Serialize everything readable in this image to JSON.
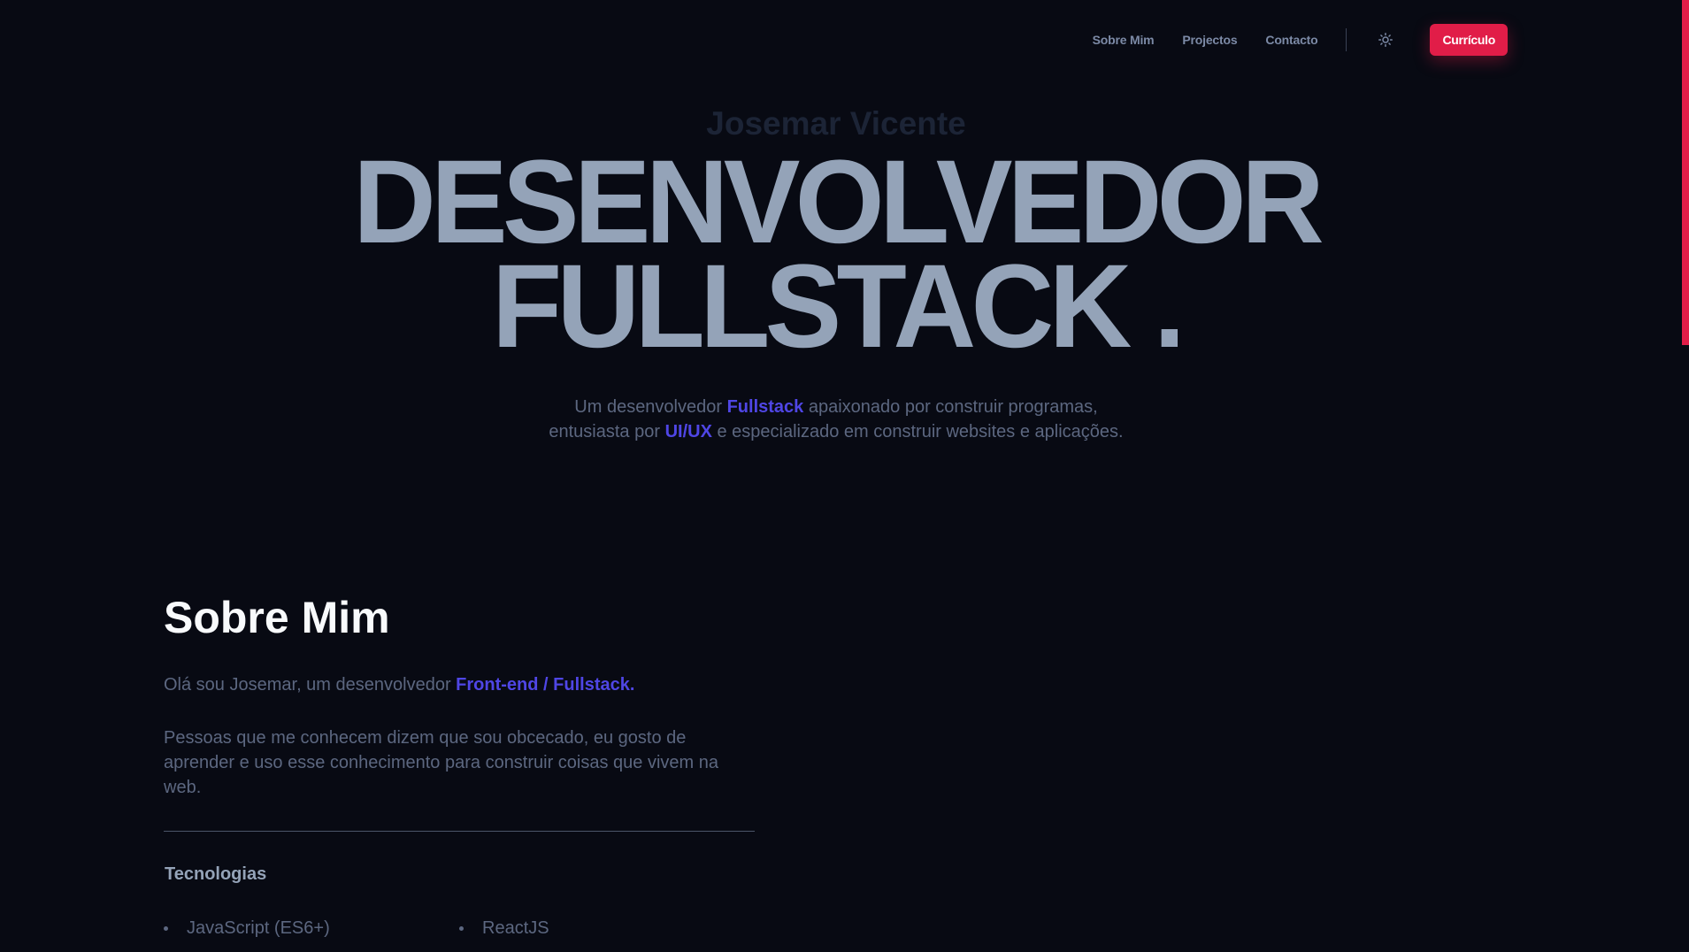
{
  "nav": {
    "links": [
      {
        "label": "Sobre Mim"
      },
      {
        "label": "Projectos"
      },
      {
        "label": "Contacto"
      }
    ],
    "theme_icon": "sun-icon",
    "resume_label": "Currículo"
  },
  "hero": {
    "name": "Josemar Vicente",
    "title_line1": "DESENVOLVEDOR",
    "title_line2": "FULLSTACK .",
    "sub_part1": "Um desenvolvedor ",
    "sub_accent1": "Fullstack",
    "sub_part2": " apaixonado por construir programas,",
    "sub_part3": "entusiasta por ",
    "sub_accent2": "UI/UX",
    "sub_part4": " e especializado em construir websites e aplicações."
  },
  "about": {
    "title": "Sobre Mim",
    "intro_part1": "Olá sou Josemar, um desenvolvedor ",
    "intro_accent": "Front-end / Fullstack.",
    "paragraph": "Pessoas que me conhecem dizem que sou obcecado, eu gosto de aprender e uso esse conhecimento para construir coisas que vivem na web.",
    "tech_title": "Tecnologias",
    "tech_items": [
      "JavaScript (ES6+)",
      "ReactJS"
    ]
  },
  "colors": {
    "background": "#080a13",
    "accent": "#4f46e5",
    "brand": "#e11d48",
    "hero_text": "#94a3b8"
  }
}
